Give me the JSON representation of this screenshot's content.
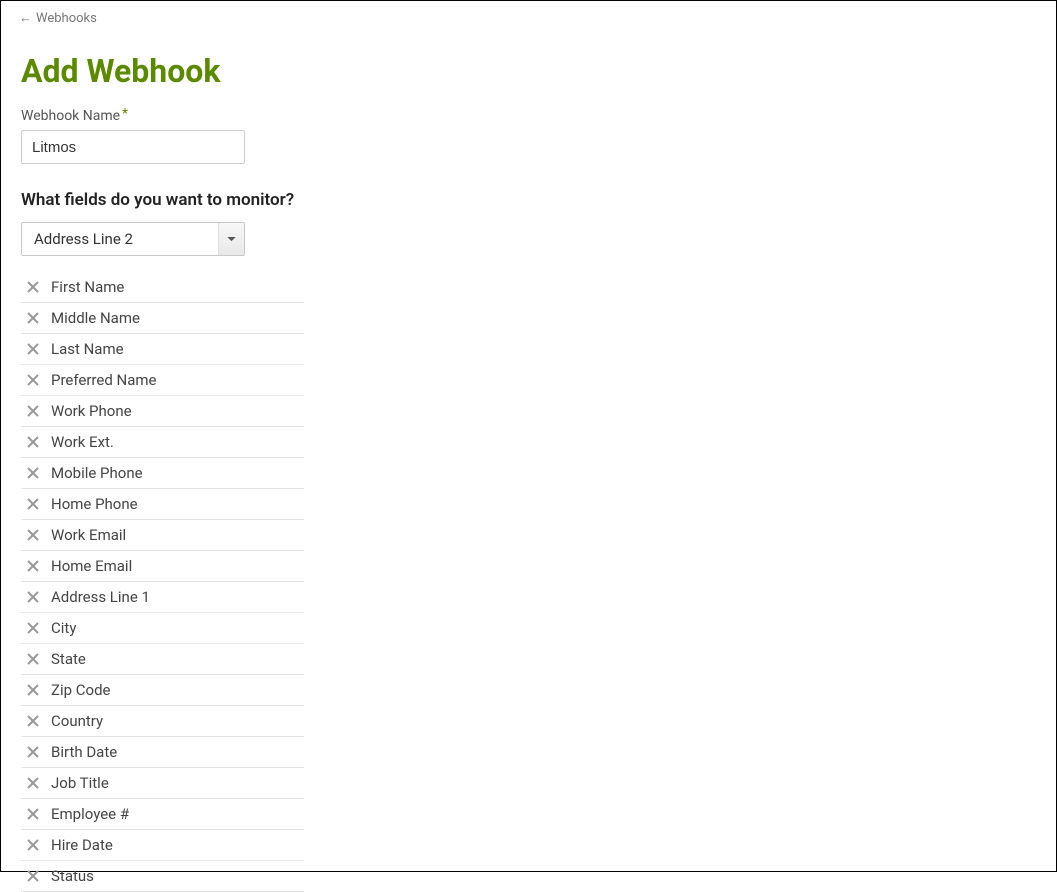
{
  "breadcrumb": {
    "label": "Webhooks"
  },
  "page": {
    "title": "Add Webhook"
  },
  "name_field": {
    "label": "Webhook Name",
    "value": "Litmos"
  },
  "monitor_section": {
    "heading": "What fields do you want to monitor?",
    "select_value": "Address Line 2"
  },
  "fields": [
    {
      "label": "First Name"
    },
    {
      "label": "Middle Name"
    },
    {
      "label": "Last Name"
    },
    {
      "label": "Preferred Name"
    },
    {
      "label": "Work Phone"
    },
    {
      "label": "Work Ext."
    },
    {
      "label": "Mobile Phone"
    },
    {
      "label": "Home Phone"
    },
    {
      "label": "Work Email"
    },
    {
      "label": "Home Email"
    },
    {
      "label": "Address Line 1"
    },
    {
      "label": "City"
    },
    {
      "label": "State"
    },
    {
      "label": "Zip Code"
    },
    {
      "label": "Country"
    },
    {
      "label": "Birth Date"
    },
    {
      "label": "Job Title"
    },
    {
      "label": "Employee #"
    },
    {
      "label": "Hire Date"
    },
    {
      "label": "Status"
    }
  ]
}
